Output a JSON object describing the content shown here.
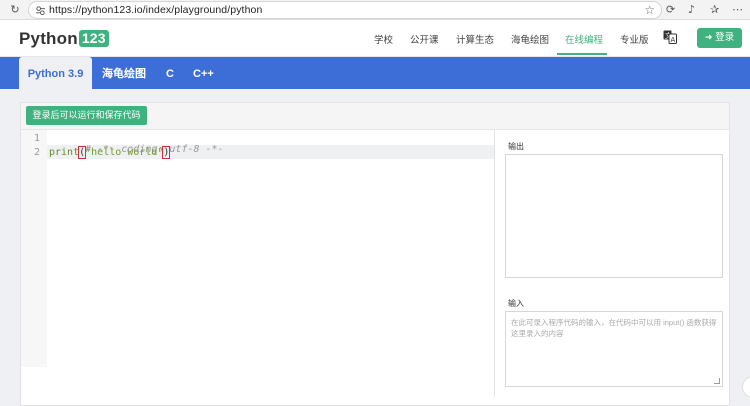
{
  "browser": {
    "url": "https://python123.io/index/playground/python",
    "reload_glyph": "↻",
    "star_glyph": "☆",
    "toolbar_glyphs": [
      "⟳",
      "♪",
      "✰",
      "⋯"
    ]
  },
  "header": {
    "logo_text": "Python",
    "logo_badge": "123",
    "nav": [
      "学校",
      "公开课",
      "计算生态",
      "海龟绘图",
      "在线编程",
      "专业版"
    ],
    "active_nav": "在线编程",
    "login_label": "登录",
    "login_icon": "sign-in-icon"
  },
  "tabs": [
    "Python 3.9",
    "海龟绘图",
    "C",
    "C++"
  ],
  "active_tab": "Python 3.9",
  "toolbar": {
    "run_label": "登录后可以运行和保存代码"
  },
  "editor": {
    "line_numbers": [
      "1",
      "2"
    ],
    "line1": "# -*- coding: utf-8 -*-",
    "line2_func": "print",
    "line2_open": "(",
    "line2_string": "\"hello world\"",
    "line2_close": ")"
  },
  "side": {
    "output_label": "输出",
    "input_label": "输入",
    "input_placeholder": "在此可录入程序代码的输入，在代码中可以用 input() 函数获得这里录入的内容"
  },
  "colors": {
    "accent_green": "#3fb27f",
    "tab_blue": "#3d6ed8"
  }
}
